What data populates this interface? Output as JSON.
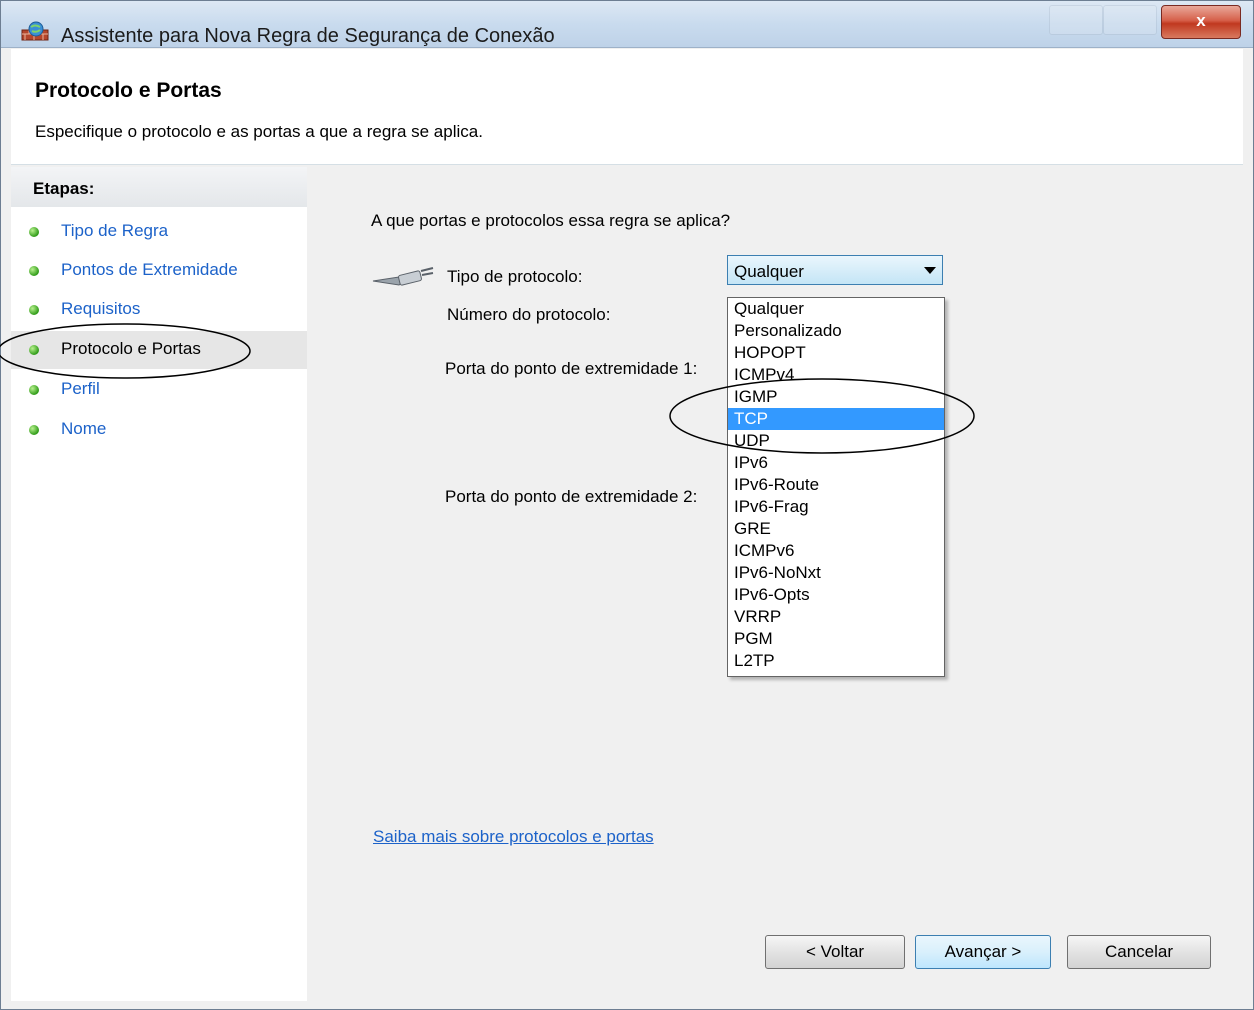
{
  "window": {
    "title": "Assistente para Nova Regra de Segurança de Conexão",
    "close_label": "x"
  },
  "header": {
    "title": "Protocolo e Portas",
    "description": "Especifique o protocolo e as portas a que a regra se aplica."
  },
  "steps": {
    "heading": "Etapas:",
    "items": [
      {
        "label": "Tipo de Regra"
      },
      {
        "label": "Pontos de Extremidade"
      },
      {
        "label": "Requisitos"
      },
      {
        "label": "Protocolo e Portas"
      },
      {
        "label": "Perfil"
      },
      {
        "label": "Nome"
      }
    ],
    "active_index": 3
  },
  "main": {
    "question": "A que portas e protocolos essa regra se aplica?",
    "protocol_type_label": "Tipo de protocolo:",
    "protocol_number_label": "Número do protocolo:",
    "endpoint_port1_label": "Porta do ponto de extremidade 1:",
    "endpoint_port2_label": "Porta do ponto de extremidade 2:",
    "protocol_select": {
      "value": "Qualquer",
      "options": [
        "Qualquer",
        "Personalizado",
        "HOPOPT",
        "ICMPv4",
        "IGMP",
        "TCP",
        "UDP",
        "IPv6",
        "IPv6-Route",
        "IPv6-Frag",
        "GRE",
        "ICMPv6",
        "IPv6-NoNxt",
        "IPv6-Opts",
        "VRRP",
        "PGM",
        "L2TP"
      ],
      "highlighted": "TCP"
    },
    "learn_more_link": "Saiba mais sobre protocolos e portas"
  },
  "buttons": {
    "back": "< Voltar",
    "next": "Avançar >",
    "cancel": "Cancelar"
  },
  "colors": {
    "link": "#1c62c9",
    "selection": "#3399ff",
    "step_bullet": "#2f9b18"
  }
}
